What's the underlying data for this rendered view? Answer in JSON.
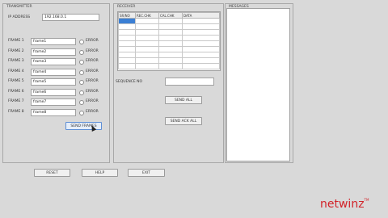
{
  "transmitter": {
    "title": "TRANSMITTER",
    "ip_label": "IP ADDRESS",
    "ip_value": "192.168.0.1",
    "frames": [
      {
        "label": "FRAME 1",
        "value": "frame1",
        "status": "ERROR"
      },
      {
        "label": "FRAME 2",
        "value": "frame2",
        "status": "ERROR"
      },
      {
        "label": "FRAME 3",
        "value": "frame3",
        "status": "ERROR"
      },
      {
        "label": "FRAME 4",
        "value": "frame4",
        "status": "ERROR"
      },
      {
        "label": "FRAME 5",
        "value": "frame5",
        "status": "ERROR"
      },
      {
        "label": "FRAME 6",
        "value": "frame6",
        "status": "ERROR"
      },
      {
        "label": "FRAME 7",
        "value": "frame7",
        "status": "ERROR"
      },
      {
        "label": "FRAME 8",
        "value": "frame8",
        "status": "ERROR"
      }
    ],
    "send_frames_label": "SEND FRAMES"
  },
  "receiver": {
    "title": "RECEIVER",
    "columns": [
      "SR/NO",
      "REC.CHK",
      "CAL.CHK",
      "DATA"
    ],
    "sequence_label": "SEQUENCE NO",
    "sequence_value": "",
    "send_all_label": "SEND ALL",
    "send_ack_all_label": "SEND ACK ALL"
  },
  "messages": {
    "title": "MESSAGES"
  },
  "footer": {
    "reset_label": "RESET",
    "help_label": "HELP",
    "exit_label": "EXIT"
  },
  "brand": {
    "name": "netwinz",
    "mark": "TM",
    "color": "#d2242a"
  }
}
